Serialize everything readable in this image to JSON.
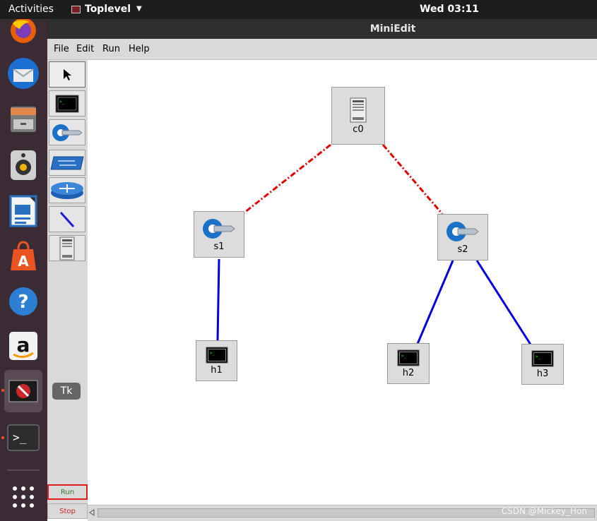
{
  "topbar": {
    "activities": "Activities",
    "app_menu": "Toplevel",
    "clock": "Wed 03:11"
  },
  "dock": {
    "items": [
      {
        "name": "firefox-icon"
      },
      {
        "name": "thunderbird-icon"
      },
      {
        "name": "files-icon"
      },
      {
        "name": "rhythmbox-icon"
      },
      {
        "name": "libreoffice-writer-icon"
      },
      {
        "name": "software-center-icon"
      },
      {
        "name": "help-icon",
        "glyph": "?"
      },
      {
        "name": "amazon-icon",
        "glyph": "a"
      },
      {
        "name": "miniedit-app-icon",
        "active": true
      },
      {
        "name": "terminal-icon"
      },
      {
        "name": "show-apps-icon"
      }
    ]
  },
  "window": {
    "title": "MiniEdit"
  },
  "menu": {
    "file": "File",
    "edit": "Edit",
    "run": "Run",
    "help": "Help"
  },
  "toolbar": {
    "tools": [
      "select",
      "host",
      "switch",
      "legacy-switch",
      "legacy-router",
      "netlink",
      "controller"
    ],
    "tk_badge": "Tk",
    "run_label": "Run",
    "stop_label": "Stop"
  },
  "topology": {
    "nodes": [
      {
        "id": "c0",
        "label": "c0",
        "type": "controller"
      },
      {
        "id": "s1",
        "label": "s1",
        "type": "switch"
      },
      {
        "id": "s2",
        "label": "s2",
        "type": "switch"
      },
      {
        "id": "h1",
        "label": "h1",
        "type": "host"
      },
      {
        "id": "h2",
        "label": "h2",
        "type": "host"
      },
      {
        "id": "h3",
        "label": "h3",
        "type": "host"
      }
    ],
    "links": [
      {
        "from": "c0",
        "to": "s1",
        "kind": "control",
        "color": "#e00000"
      },
      {
        "from": "c0",
        "to": "s2",
        "kind": "control",
        "color": "#e00000"
      },
      {
        "from": "s1",
        "to": "h1",
        "kind": "data",
        "color": "#0000e0"
      },
      {
        "from": "s2",
        "to": "h2",
        "kind": "data",
        "color": "#0000e0"
      },
      {
        "from": "s2",
        "to": "h3",
        "kind": "data",
        "color": "#0000e0"
      }
    ]
  },
  "watermark": "CSDN @Mickey_Hon"
}
